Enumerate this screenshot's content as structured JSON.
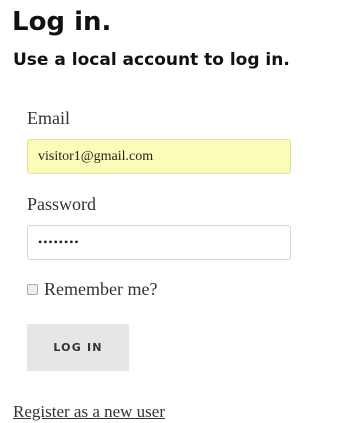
{
  "page": {
    "title": "Log in.",
    "subtitle": "Use a local account to log in."
  },
  "form": {
    "email": {
      "label": "Email",
      "value": "visitor1@gmail.com"
    },
    "password": {
      "label": "Password",
      "value": "••••••••"
    },
    "remember": {
      "label": "Remember me?",
      "checked": false
    },
    "submit_label": "LOG IN"
  },
  "links": {
    "register": "Register as a new user"
  },
  "colors": {
    "autofill_background": "#fcfcb9",
    "button_background": "#e6e6e6"
  }
}
